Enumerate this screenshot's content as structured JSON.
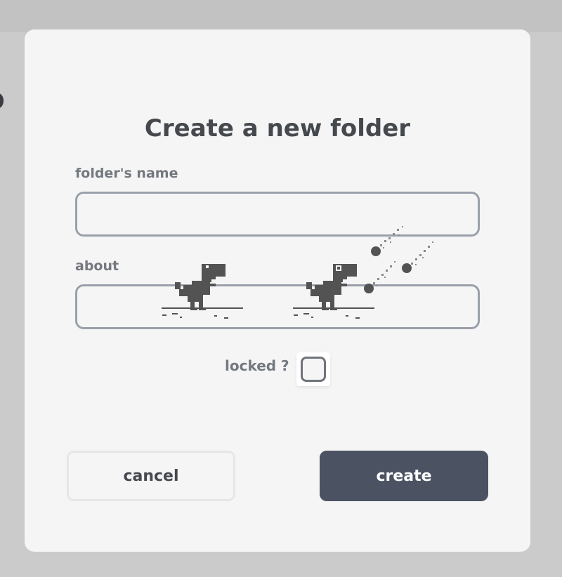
{
  "background": {
    "partial_heading": "o"
  },
  "dialog": {
    "title": "Create a new folder",
    "name_field": {
      "label": "folder's name",
      "value": "",
      "placeholder": ""
    },
    "about_field": {
      "label": "about",
      "value": "",
      "placeholder": ""
    },
    "locked": {
      "label": "locked ?",
      "checked": false
    },
    "buttons": {
      "cancel": "cancel",
      "create": "create"
    }
  },
  "colors": {
    "modal_bg": "#f5f5f5",
    "page_bg": "#cbcbcb",
    "create_button": "#4b5362",
    "title_text": "#45484d",
    "label_text": "#74787f",
    "input_border": "#9aa0aa"
  },
  "icons": {
    "decoration": [
      "dino-running-icon",
      "dino-hit-icon",
      "meteor-icon"
    ]
  }
}
